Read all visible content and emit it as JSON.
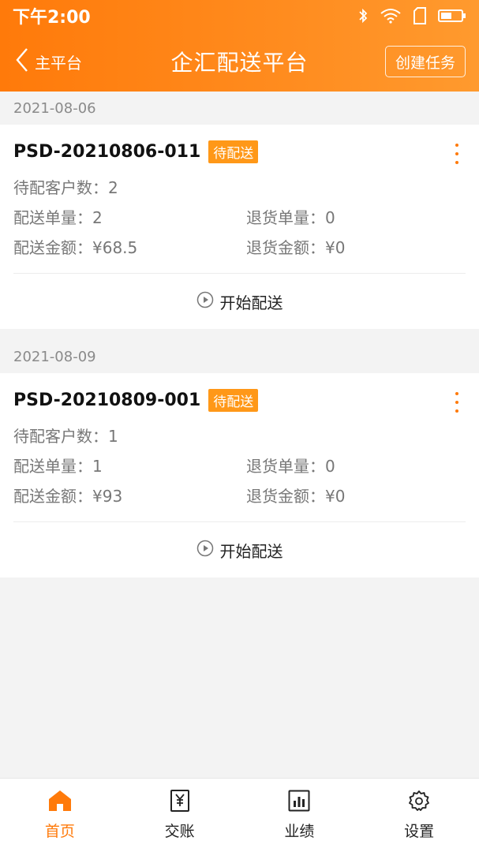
{
  "status_bar": {
    "time": "下午2:00"
  },
  "header": {
    "back_label": "主平台",
    "title": "企汇配送平台",
    "create_button": "创建任务"
  },
  "groups": [
    {
      "date": "2021-08-06",
      "order": {
        "order_no": "PSD-20210806-011",
        "status": "待配送",
        "pending_customers": "待配客户数：2",
        "delivery_qty": "配送单量：2",
        "return_qty": "退货单量：0",
        "delivery_amount": "配送金额：¥68.5",
        "return_amount": "退货金额：¥0",
        "action": "开始配送"
      }
    },
    {
      "date": "2021-08-09",
      "order": {
        "order_no": "PSD-20210809-001",
        "status": "待配送",
        "pending_customers": "待配客户数：1",
        "delivery_qty": "配送单量：1",
        "return_qty": "退货单量：0",
        "delivery_amount": "配送金额：¥93",
        "return_amount": "退货金额：¥0",
        "action": "开始配送"
      }
    }
  ],
  "tabbar": {
    "active": "home",
    "items": [
      {
        "key": "home",
        "label": "首页",
        "icon": "home-icon"
      },
      {
        "key": "settlement",
        "label": "交账",
        "icon": "yuan-receipt-icon"
      },
      {
        "key": "performance",
        "label": "业绩",
        "icon": "bar-chart-icon"
      },
      {
        "key": "settings",
        "label": "设置",
        "icon": "gear-icon"
      }
    ]
  },
  "colors": {
    "accent": "#ff7a0a",
    "badge": "#ff9818",
    "background": "#f3f3f3"
  }
}
